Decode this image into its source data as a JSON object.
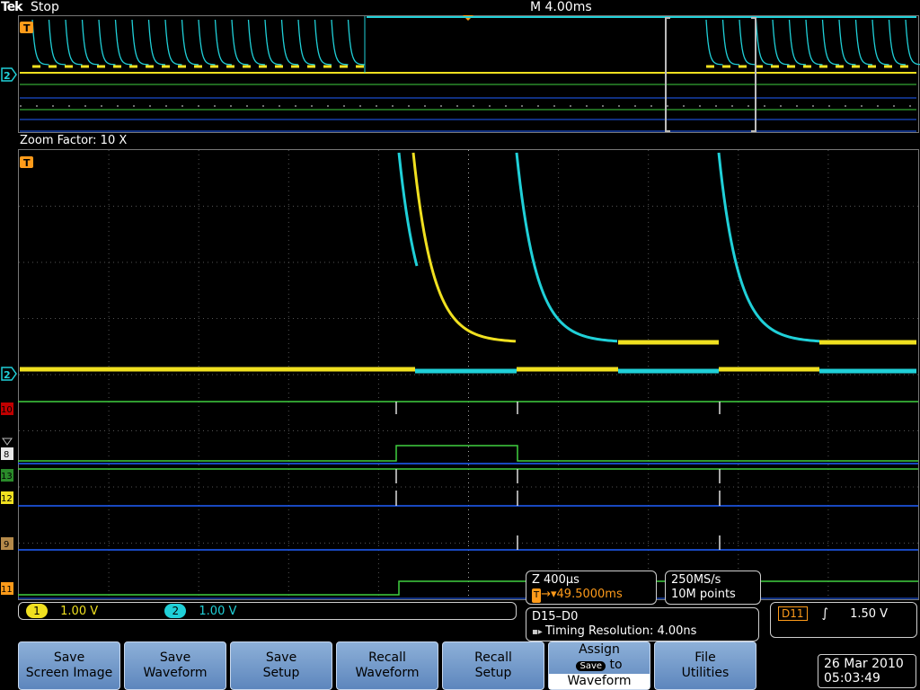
{
  "header": {
    "brand": "Tek",
    "acq_state": "Stop",
    "timebase": "M 4.00ms"
  },
  "zoom": {
    "label": "Zoom Factor: 10 X"
  },
  "markers": {
    "trigger": "T",
    "ch2": "2",
    "d10": "10",
    "d8": "8",
    "d13": "13",
    "d12": "12",
    "d9": "9",
    "d11": "11"
  },
  "channels": {
    "ch1": {
      "num": "1",
      "scale": "1.00 V",
      "color": "#f0e020"
    },
    "ch2": {
      "num": "2",
      "scale": "1.00 V",
      "color": "#20d0d8"
    }
  },
  "zoom_readout": {
    "scale": "Z 400µs",
    "position": "49.5000ms",
    "trig_glyph": "T"
  },
  "acquisition": {
    "rate": "250MS/s",
    "record": "10M points"
  },
  "digital": {
    "group": "D15–D0",
    "resolution": "Timing Resolution: 4.00ns"
  },
  "trigger": {
    "source": "D11",
    "slope": "rising-edge-icon",
    "level": "1.50 V"
  },
  "softkeys": [
    {
      "line1": "Save",
      "line2": "Screen Image"
    },
    {
      "line1": "Save",
      "line2": "Waveform"
    },
    {
      "line1": "Save",
      "line2": "Setup"
    },
    {
      "line1": "Recall",
      "line2": "Waveform"
    },
    {
      "line1": "Recall",
      "line2": "Setup"
    },
    {
      "line1": "Assign",
      "badge": "Save",
      "mid": "to",
      "line2": "Waveform"
    },
    {
      "line1": "File",
      "line2": "Utilities"
    }
  ],
  "clock": {
    "date": "26 Mar 2010",
    "time": "05:03:49"
  },
  "colors": {
    "grid": "#555555",
    "ch1": "#f0e020",
    "ch2": "#20d0d8",
    "digital_green": "#40d040",
    "digital_blue": "#2060ff",
    "accent": "#ff9b1a"
  }
}
